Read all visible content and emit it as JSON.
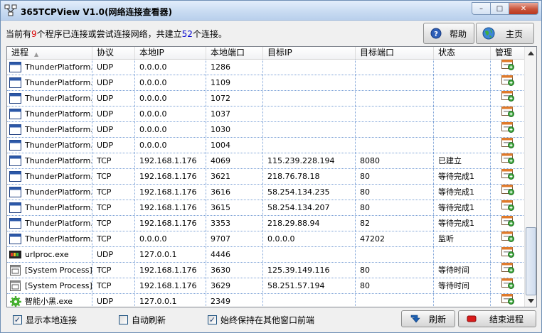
{
  "window": {
    "title": "365TCPView V1.0(网络连接查看器)",
    "minimize": "–",
    "maximize": "□",
    "close": "✕"
  },
  "info": {
    "prefix": "当前有",
    "program_count": "9",
    "middle": "个程序已连接或尝试连接网络，共建立",
    "connection_count": "52",
    "suffix": "个连接。"
  },
  "toolbar": {
    "help_label": "帮助",
    "home_label": "主页"
  },
  "columns": [
    "进程",
    "协议",
    "本地IP",
    "本地端口",
    "目标IP",
    "目标端口",
    "状态",
    "管理"
  ],
  "sort_indicator": "▲",
  "rows": [
    {
      "icon": "window-icon",
      "process": "ThunderPlatform...",
      "protocol": "UDP",
      "local_ip": "0.0.0.0",
      "local_port": "1286",
      "remote_ip": "",
      "remote_port": "",
      "state": ""
    },
    {
      "icon": "window-icon",
      "process": "ThunderPlatform...",
      "protocol": "UDP",
      "local_ip": "0.0.0.0",
      "local_port": "1109",
      "remote_ip": "",
      "remote_port": "",
      "state": ""
    },
    {
      "icon": "window-icon",
      "process": "ThunderPlatform...",
      "protocol": "UDP",
      "local_ip": "0.0.0.0",
      "local_port": "1072",
      "remote_ip": "",
      "remote_port": "",
      "state": ""
    },
    {
      "icon": "window-icon",
      "process": "ThunderPlatform...",
      "protocol": "UDP",
      "local_ip": "0.0.0.0",
      "local_port": "1037",
      "remote_ip": "",
      "remote_port": "",
      "state": ""
    },
    {
      "icon": "window-icon",
      "process": "ThunderPlatform...",
      "protocol": "UDP",
      "local_ip": "0.0.0.0",
      "local_port": "1030",
      "remote_ip": "",
      "remote_port": "",
      "state": ""
    },
    {
      "icon": "window-icon",
      "process": "ThunderPlatform...",
      "protocol": "UDP",
      "local_ip": "0.0.0.0",
      "local_port": "1004",
      "remote_ip": "",
      "remote_port": "",
      "state": ""
    },
    {
      "icon": "window-icon",
      "process": "ThunderPlatform...",
      "protocol": "TCP",
      "local_ip": "192.168.1.176",
      "local_port": "4069",
      "remote_ip": "115.239.228.194",
      "remote_port": "8080",
      "state": "已建立"
    },
    {
      "icon": "window-icon",
      "process": "ThunderPlatform...",
      "protocol": "TCP",
      "local_ip": "192.168.1.176",
      "local_port": "3621",
      "remote_ip": "218.76.78.18",
      "remote_port": "80",
      "state": "等待完成1"
    },
    {
      "icon": "window-icon",
      "process": "ThunderPlatform...",
      "protocol": "TCP",
      "local_ip": "192.168.1.176",
      "local_port": "3616",
      "remote_ip": "58.254.134.235",
      "remote_port": "80",
      "state": "等待完成1"
    },
    {
      "icon": "window-icon",
      "process": "ThunderPlatform...",
      "protocol": "TCP",
      "local_ip": "192.168.1.176",
      "local_port": "3615",
      "remote_ip": "58.254.134.207",
      "remote_port": "80",
      "state": "等待完成1"
    },
    {
      "icon": "window-icon",
      "process": "ThunderPlatform...",
      "protocol": "TCP",
      "local_ip": "192.168.1.176",
      "local_port": "3353",
      "remote_ip": "218.29.88.94",
      "remote_port": "82",
      "state": "等待完成1"
    },
    {
      "icon": "window-icon",
      "process": "ThunderPlatform...",
      "protocol": "TCP",
      "local_ip": "0.0.0.0",
      "local_port": "9707",
      "remote_ip": "0.0.0.0",
      "remote_port": "47202",
      "state": "监听"
    },
    {
      "icon": "urlproc-icon",
      "process": "urlproc.exe",
      "protocol": "UDP",
      "local_ip": "127.0.0.1",
      "local_port": "4446",
      "remote_ip": "",
      "remote_port": "",
      "state": ""
    },
    {
      "icon": "system-process-icon",
      "process": "[System Process]",
      "protocol": "TCP",
      "local_ip": "192.168.1.176",
      "local_port": "3630",
      "remote_ip": "125.39.149.116",
      "remote_port": "80",
      "state": "等待时间"
    },
    {
      "icon": "system-process-icon",
      "process": "[System Process]",
      "protocol": "TCP",
      "local_ip": "192.168.1.176",
      "local_port": "3629",
      "remote_ip": "58.251.57.194",
      "remote_port": "80",
      "state": "等待时间"
    },
    {
      "icon": "green-gear-icon",
      "process": "智能小黑.exe",
      "protocol": "UDP",
      "local_ip": "127.0.0.1",
      "local_port": "2349",
      "remote_ip": "",
      "remote_port": "",
      "state": ""
    }
  ],
  "footer": {
    "show_local_label": "显示本地连接",
    "show_local_checked": true,
    "auto_refresh_label": "自动刷新",
    "auto_refresh_checked": false,
    "always_on_top_label": "始终保持在其他窗口前端",
    "always_on_top_checked": true,
    "refresh_label": "刷新",
    "end_process_label": "结束进程"
  }
}
